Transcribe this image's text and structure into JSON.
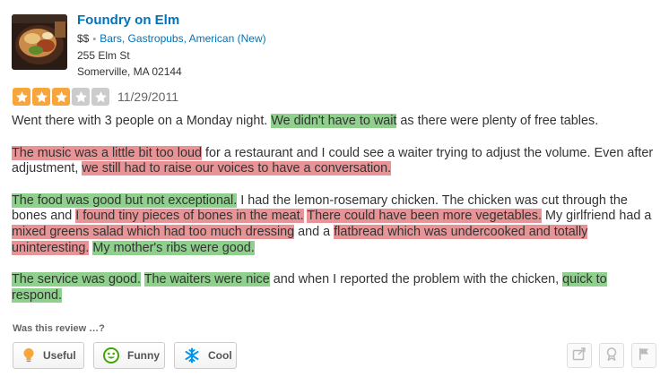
{
  "business": {
    "name": "Foundry on Elm",
    "price": "$$",
    "categories": "Bars, Gastropubs, American (New)",
    "street": "255 Elm St",
    "city": "Somerville, MA 02144",
    "thumbnail_icon": "food-photo"
  },
  "review": {
    "stars": 3,
    "max_stars": 5,
    "date": "11/29/2011",
    "paragraphs": [
      [
        {
          "t": "Went there with 3 people on a Monday night. ",
          "h": ""
        },
        {
          "t": "We didn't have to wait",
          "h": "g"
        },
        {
          "t": " as there were plenty of free tables.",
          "h": ""
        }
      ],
      [
        {
          "t": "The music was a little bit too loud",
          "h": "r"
        },
        {
          "t": " for a restaurant and I could see a waiter trying to adjust the volume. Even after adjustment, ",
          "h": ""
        },
        {
          "t": "we still had to raise our voices to have a conversation.",
          "h": "r"
        }
      ],
      [
        {
          "t": "The food was good but not exceptional.",
          "h": "g"
        },
        {
          "t": " I had the lemon-rosemary chicken. The chicken was cut through the bones and ",
          "h": ""
        },
        {
          "t": "I found tiny pieces of bones in the meat.",
          "h": "r"
        },
        {
          "t": " ",
          "h": ""
        },
        {
          "t": "There could have been more vegetables.",
          "h": "r"
        },
        {
          "t": " My girlfriend had a ",
          "h": ""
        },
        {
          "t": "mixed greens salad which had too much dressing",
          "h": "r"
        },
        {
          "t": " and a ",
          "h": ""
        },
        {
          "t": "flatbread which was undercooked and totally uninteresting.",
          "h": "r"
        },
        {
          "t": " ",
          "h": ""
        },
        {
          "t": "My mother's ribs were good.",
          "h": "g"
        }
      ],
      [
        {
          "t": "The service was good.",
          "h": "g"
        },
        {
          "t": " ",
          "h": ""
        },
        {
          "t": "The waiters were nice",
          "h": "g"
        },
        {
          "t": " and when I reported the problem with the chicken, ",
          "h": ""
        },
        {
          "t": "quick to respond.",
          "h": "g"
        }
      ]
    ]
  },
  "feedback": {
    "prompt": "Was this review …?",
    "buttons": [
      {
        "label": "Useful",
        "icon": "lightbulb-icon"
      },
      {
        "label": "Funny",
        "icon": "smiley-icon"
      },
      {
        "label": "Cool",
        "icon": "snowflake-icon"
      }
    ]
  },
  "actions": [
    {
      "icon": "share-icon"
    },
    {
      "icon": "compliment-icon"
    },
    {
      "icon": "flag-icon"
    }
  ],
  "colors": {
    "link": "#0073bb",
    "star_on": "#f8a53b",
    "star_off": "#cccccc",
    "highlight_positive": "#8ed08c",
    "highlight_negative": "#e89496"
  }
}
